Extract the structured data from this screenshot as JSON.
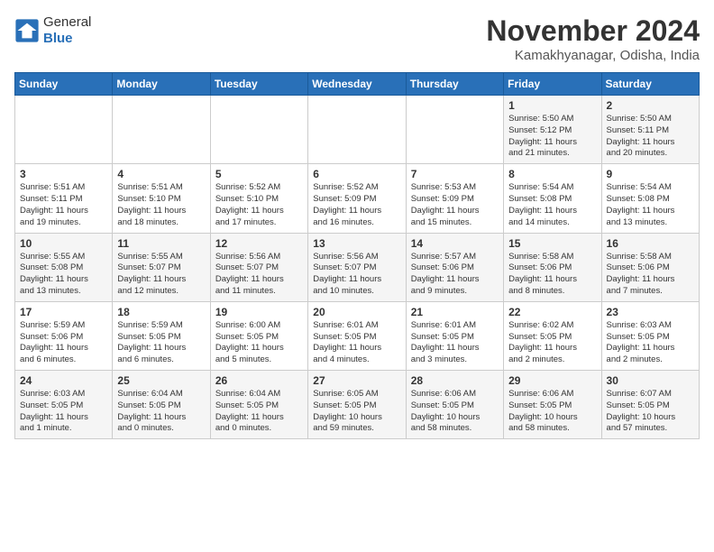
{
  "header": {
    "logo_line1": "General",
    "logo_line2": "Blue",
    "month": "November 2024",
    "location": "Kamakhyanagar, Odisha, India"
  },
  "days_of_week": [
    "Sunday",
    "Monday",
    "Tuesday",
    "Wednesday",
    "Thursday",
    "Friday",
    "Saturday"
  ],
  "weeks": [
    [
      {
        "day": "",
        "text": ""
      },
      {
        "day": "",
        "text": ""
      },
      {
        "day": "",
        "text": ""
      },
      {
        "day": "",
        "text": ""
      },
      {
        "day": "",
        "text": ""
      },
      {
        "day": "1",
        "text": "Sunrise: 5:50 AM\nSunset: 5:12 PM\nDaylight: 11 hours\nand 21 minutes."
      },
      {
        "day": "2",
        "text": "Sunrise: 5:50 AM\nSunset: 5:11 PM\nDaylight: 11 hours\nand 20 minutes."
      }
    ],
    [
      {
        "day": "3",
        "text": "Sunrise: 5:51 AM\nSunset: 5:11 PM\nDaylight: 11 hours\nand 19 minutes."
      },
      {
        "day": "4",
        "text": "Sunrise: 5:51 AM\nSunset: 5:10 PM\nDaylight: 11 hours\nand 18 minutes."
      },
      {
        "day": "5",
        "text": "Sunrise: 5:52 AM\nSunset: 5:10 PM\nDaylight: 11 hours\nand 17 minutes."
      },
      {
        "day": "6",
        "text": "Sunrise: 5:52 AM\nSunset: 5:09 PM\nDaylight: 11 hours\nand 16 minutes."
      },
      {
        "day": "7",
        "text": "Sunrise: 5:53 AM\nSunset: 5:09 PM\nDaylight: 11 hours\nand 15 minutes."
      },
      {
        "day": "8",
        "text": "Sunrise: 5:54 AM\nSunset: 5:08 PM\nDaylight: 11 hours\nand 14 minutes."
      },
      {
        "day": "9",
        "text": "Sunrise: 5:54 AM\nSunset: 5:08 PM\nDaylight: 11 hours\nand 13 minutes."
      }
    ],
    [
      {
        "day": "10",
        "text": "Sunrise: 5:55 AM\nSunset: 5:08 PM\nDaylight: 11 hours\nand 13 minutes."
      },
      {
        "day": "11",
        "text": "Sunrise: 5:55 AM\nSunset: 5:07 PM\nDaylight: 11 hours\nand 12 minutes."
      },
      {
        "day": "12",
        "text": "Sunrise: 5:56 AM\nSunset: 5:07 PM\nDaylight: 11 hours\nand 11 minutes."
      },
      {
        "day": "13",
        "text": "Sunrise: 5:56 AM\nSunset: 5:07 PM\nDaylight: 11 hours\nand 10 minutes."
      },
      {
        "day": "14",
        "text": "Sunrise: 5:57 AM\nSunset: 5:06 PM\nDaylight: 11 hours\nand 9 minutes."
      },
      {
        "day": "15",
        "text": "Sunrise: 5:58 AM\nSunset: 5:06 PM\nDaylight: 11 hours\nand 8 minutes."
      },
      {
        "day": "16",
        "text": "Sunrise: 5:58 AM\nSunset: 5:06 PM\nDaylight: 11 hours\nand 7 minutes."
      }
    ],
    [
      {
        "day": "17",
        "text": "Sunrise: 5:59 AM\nSunset: 5:06 PM\nDaylight: 11 hours\nand 6 minutes."
      },
      {
        "day": "18",
        "text": "Sunrise: 5:59 AM\nSunset: 5:05 PM\nDaylight: 11 hours\nand 6 minutes."
      },
      {
        "day": "19",
        "text": "Sunrise: 6:00 AM\nSunset: 5:05 PM\nDaylight: 11 hours\nand 5 minutes."
      },
      {
        "day": "20",
        "text": "Sunrise: 6:01 AM\nSunset: 5:05 PM\nDaylight: 11 hours\nand 4 minutes."
      },
      {
        "day": "21",
        "text": "Sunrise: 6:01 AM\nSunset: 5:05 PM\nDaylight: 11 hours\nand 3 minutes."
      },
      {
        "day": "22",
        "text": "Sunrise: 6:02 AM\nSunset: 5:05 PM\nDaylight: 11 hours\nand 2 minutes."
      },
      {
        "day": "23",
        "text": "Sunrise: 6:03 AM\nSunset: 5:05 PM\nDaylight: 11 hours\nand 2 minutes."
      }
    ],
    [
      {
        "day": "24",
        "text": "Sunrise: 6:03 AM\nSunset: 5:05 PM\nDaylight: 11 hours\nand 1 minute."
      },
      {
        "day": "25",
        "text": "Sunrise: 6:04 AM\nSunset: 5:05 PM\nDaylight: 11 hours\nand 0 minutes."
      },
      {
        "day": "26",
        "text": "Sunrise: 6:04 AM\nSunset: 5:05 PM\nDaylight: 11 hours\nand 0 minutes."
      },
      {
        "day": "27",
        "text": "Sunrise: 6:05 AM\nSunset: 5:05 PM\nDaylight: 10 hours\nand 59 minutes."
      },
      {
        "day": "28",
        "text": "Sunrise: 6:06 AM\nSunset: 5:05 PM\nDaylight: 10 hours\nand 58 minutes."
      },
      {
        "day": "29",
        "text": "Sunrise: 6:06 AM\nSunset: 5:05 PM\nDaylight: 10 hours\nand 58 minutes."
      },
      {
        "day": "30",
        "text": "Sunrise: 6:07 AM\nSunset: 5:05 PM\nDaylight: 10 hours\nand 57 minutes."
      }
    ]
  ]
}
